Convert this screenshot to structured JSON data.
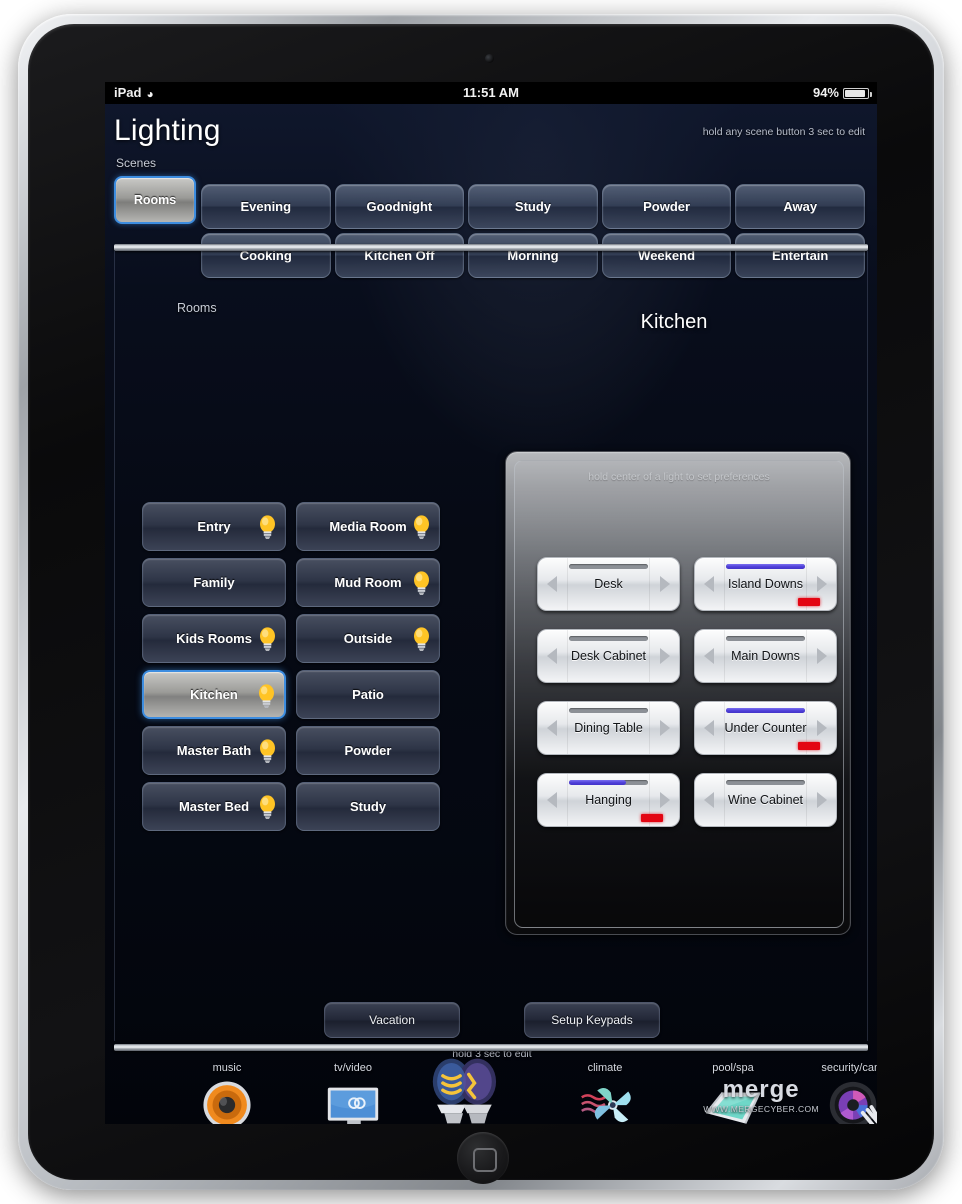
{
  "status_bar": {
    "carrier": "iPad",
    "wifi_icon": "wifi-icon",
    "time": "11:51 AM",
    "battery_percent": "94%",
    "battery_level": 94
  },
  "header": {
    "title": "Lighting",
    "scenes_label": "Scenes",
    "hint": "hold any scene button 3 sec to edit",
    "rooms_tab_label": "Rooms",
    "accent_color": "#3d8de0"
  },
  "scenes": [
    {
      "label": "Evening"
    },
    {
      "label": "Goodnight"
    },
    {
      "label": "Study"
    },
    {
      "label": "Powder"
    },
    {
      "label": "Away"
    },
    {
      "label": "Cooking"
    },
    {
      "label": "Kitchen Off"
    },
    {
      "label": "Morning"
    },
    {
      "label": "Weekend"
    },
    {
      "label": "Entertain"
    }
  ],
  "content": {
    "rooms_heading": "Rooms",
    "selected_room_title": "Kitchen"
  },
  "rooms": [
    {
      "label": "Entry",
      "bulb_on": true,
      "selected": false
    },
    {
      "label": "Media Room",
      "bulb_on": true,
      "selected": false
    },
    {
      "label": "Family",
      "bulb_on": false,
      "selected": false
    },
    {
      "label": "Mud Room",
      "bulb_on": true,
      "selected": false
    },
    {
      "label": "Kids Rooms",
      "bulb_on": true,
      "selected": false
    },
    {
      "label": "Outside",
      "bulb_on": true,
      "selected": false
    },
    {
      "label": "Kitchen",
      "bulb_on": true,
      "selected": true
    },
    {
      "label": "Patio",
      "bulb_on": false,
      "selected": false
    },
    {
      "label": "Master Bath",
      "bulb_on": true,
      "selected": false
    },
    {
      "label": "Powder",
      "bulb_on": false,
      "selected": false
    },
    {
      "label": "Master Bed",
      "bulb_on": true,
      "selected": false
    },
    {
      "label": "Study",
      "bulb_on": false,
      "selected": false
    }
  ],
  "light_panel": {
    "hint": "hold center of a light to set preferences",
    "on_color": "#4e3fd8",
    "off_color": "#8c9096",
    "led_color": "#e30613"
  },
  "lights": [
    {
      "label": "Desk",
      "level": 0,
      "on": false,
      "led": false
    },
    {
      "label": "Island Downs",
      "level": 100,
      "on": true,
      "led": true
    },
    {
      "label": "Desk Cabinet",
      "level": 0,
      "on": false,
      "led": false
    },
    {
      "label": "Main Downs",
      "level": 0,
      "on": false,
      "led": false
    },
    {
      "label": "Dining Table",
      "level": 0,
      "on": false,
      "led": false
    },
    {
      "label": "Under Counter",
      "level": 100,
      "on": true,
      "led": true
    },
    {
      "label": "Hanging",
      "level": 72,
      "on": true,
      "led": true
    },
    {
      "label": "Wine Cabinet",
      "level": 0,
      "on": false,
      "led": false
    }
  ],
  "actions": {
    "vacation_label": "Vacation",
    "setup_keypads_label": "Setup Keypads",
    "hold_hint": "hold 3 sec to edit"
  },
  "bottom_nav": [
    {
      "label": "music",
      "icon": "speaker-icon"
    },
    {
      "label": "tv/video",
      "icon": "television-icon"
    },
    {
      "label": "",
      "icon": "lightbulbs-icon"
    },
    {
      "label": "climate",
      "icon": "fan-icon"
    },
    {
      "label": "pool/spa",
      "icon": "pool-icon"
    },
    {
      "label": "security/cams",
      "icon": "camera-icon"
    }
  ],
  "watermark": {
    "logo": "merge",
    "url": "WWW.MERGECYBER.COM"
  }
}
